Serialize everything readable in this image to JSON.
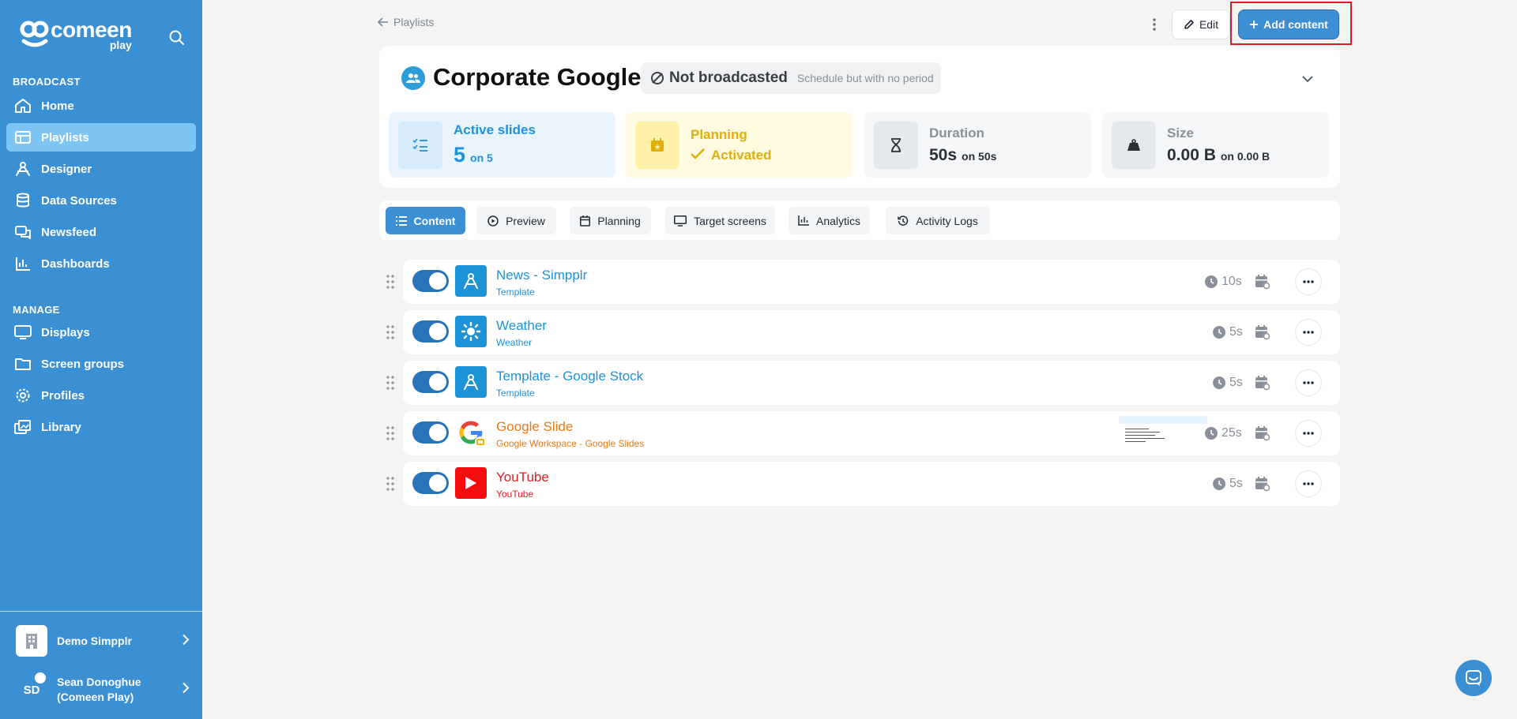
{
  "sidebar": {
    "logo_text": "comeen",
    "logo_sub": "play",
    "sections": {
      "broadcast": "BROADCAST",
      "manage": "MANAGE"
    },
    "items": [
      {
        "label": "Home",
        "icon": "home-icon"
      },
      {
        "label": "Playlists",
        "icon": "playlists-icon"
      },
      {
        "label": "Designer",
        "icon": "designer-icon"
      },
      {
        "label": "Data Sources",
        "icon": "database-icon"
      },
      {
        "label": "Newsfeed",
        "icon": "newsfeed-icon"
      },
      {
        "label": "Dashboards",
        "icon": "dashboards-icon"
      },
      {
        "label": "Displays",
        "icon": "monitor-icon"
      },
      {
        "label": "Screen groups",
        "icon": "folder-icon"
      },
      {
        "label": "Profiles",
        "icon": "gear-icon"
      },
      {
        "label": "Library",
        "icon": "library-icon"
      }
    ],
    "org": "Demo Simpplr",
    "user": {
      "initials": "SD",
      "name_line1": "Sean Donoghue",
      "name_line2": "(Comeen Play)"
    }
  },
  "topbar": {
    "back_label": "Playlists",
    "edit_label": "Edit",
    "add_label": "Add content"
  },
  "playlist": {
    "title": "Corporate Google",
    "status": "Not broadcasted",
    "status_note": "Schedule but with no period",
    "stats": {
      "active_slides": {
        "label": "Active slides",
        "value": "5",
        "suffix": "on 5"
      },
      "planning": {
        "label": "Planning",
        "value": "Activated"
      },
      "duration": {
        "label": "Duration",
        "value": "50s",
        "suffix": "on 50s"
      },
      "size": {
        "label": "Size",
        "value": "0.00 B",
        "suffix": "on 0.00 B"
      }
    }
  },
  "tabs": [
    {
      "label": "Content",
      "icon": "list-icon"
    },
    {
      "label": "Preview",
      "icon": "play-circle-icon"
    },
    {
      "label": "Planning",
      "icon": "calendar-icon"
    },
    {
      "label": "Target screens",
      "icon": "monitor-icon"
    },
    {
      "label": "Analytics",
      "icon": "chart-icon"
    },
    {
      "label": "Activity Logs",
      "icon": "history-icon"
    }
  ],
  "rows": [
    {
      "title": "News - Simpplr",
      "subtitle": "Template",
      "duration": "10s",
      "icon": "designer-icon",
      "color": "#1d93d7"
    },
    {
      "title": "Weather",
      "subtitle": "Weather",
      "duration": "5s",
      "icon": "weather-icon",
      "color": "#1d93d7"
    },
    {
      "title": "Template - Google Stock",
      "subtitle": "Template",
      "duration": "5s",
      "icon": "designer-icon",
      "color": "#1d93d7"
    },
    {
      "title": "Google Slide",
      "subtitle": "Google Workspace - Google Slides",
      "duration": "25s",
      "icon": "google-slides-icon",
      "color": "#ee7a14"
    },
    {
      "title": "YouTube",
      "subtitle": "YouTube",
      "duration": "5s",
      "icon": "youtube-icon",
      "color": "#e31b23"
    }
  ],
  "colors": {
    "sidebar": "#3b8fd3",
    "accent": "#3d8fd4",
    "active_nav": "#7ec5f4",
    "planning_yellow": "#deaf0a",
    "highlight_outline": "#d81b27"
  }
}
